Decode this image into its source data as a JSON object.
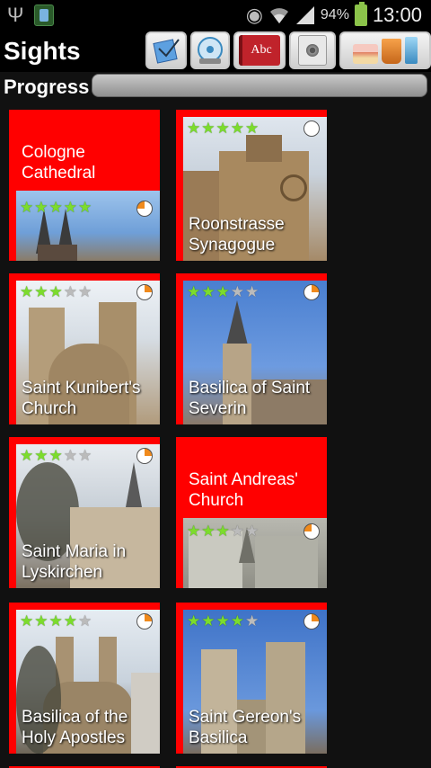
{
  "status_bar": {
    "battery": "94%",
    "time": "13:00",
    "icons": [
      "usb-icon",
      "app-notification-icon",
      "eye-icon",
      "wifi-icon",
      "signal-icon",
      "battery-charging-icon"
    ]
  },
  "header": {
    "title": "Sights",
    "toolbar": [
      {
        "name": "notes-button",
        "icon": "notes-icon"
      },
      {
        "name": "audio-guide-button",
        "icon": "audio-disc-icon"
      },
      {
        "name": "dictionary-button",
        "icon": "abc-book-icon",
        "label": "Abc"
      },
      {
        "name": "speaker-button",
        "icon": "speaker-icon"
      },
      {
        "name": "food-button",
        "icon": "food-drink-icon"
      }
    ]
  },
  "progress": {
    "label": "Progress",
    "value": 0.0
  },
  "colors": {
    "card_accent": "#ff0000",
    "star_filled": "#7cdc2c",
    "star_empty": "#bbbbbb",
    "progress_pie": "#f08a1c"
  },
  "sights": [
    {
      "name": "Cologne Cathedral",
      "stars": 5,
      "title_line1": "Cologne",
      "title_line2": "Cathedral"
    },
    {
      "name": "Roonstrasse Synagogue",
      "stars": 5,
      "title_line1": "Roonstrasse",
      "title_line2": "Synagogue"
    },
    {
      "name": "Saint Kunibert's Church",
      "stars": 3,
      "title_line1": "Saint Kunibert's",
      "title_line2": "Church"
    },
    {
      "name": "Basilica of Saint Severin",
      "stars": 3,
      "title_line1": "Basilica of Saint",
      "title_line2": "Severin"
    },
    {
      "name": "Saint Maria in Lyskirchen",
      "stars": 3,
      "title_line1": "Saint Maria in",
      "title_line2": "Lyskirchen"
    },
    {
      "name": "Saint Andreas' Church",
      "stars": 3,
      "title_line1": "Saint Andreas'",
      "title_line2": "Church"
    },
    {
      "name": "Basilica of the Holy Apostles",
      "stars": 4,
      "title_line1": "Basilica of the",
      "title_line2": "Holy Apostles"
    },
    {
      "name": "Saint Gereon's Basilica",
      "stars": 4,
      "title_line1": "Saint Gereon's",
      "title_line2": "Basilica"
    }
  ]
}
